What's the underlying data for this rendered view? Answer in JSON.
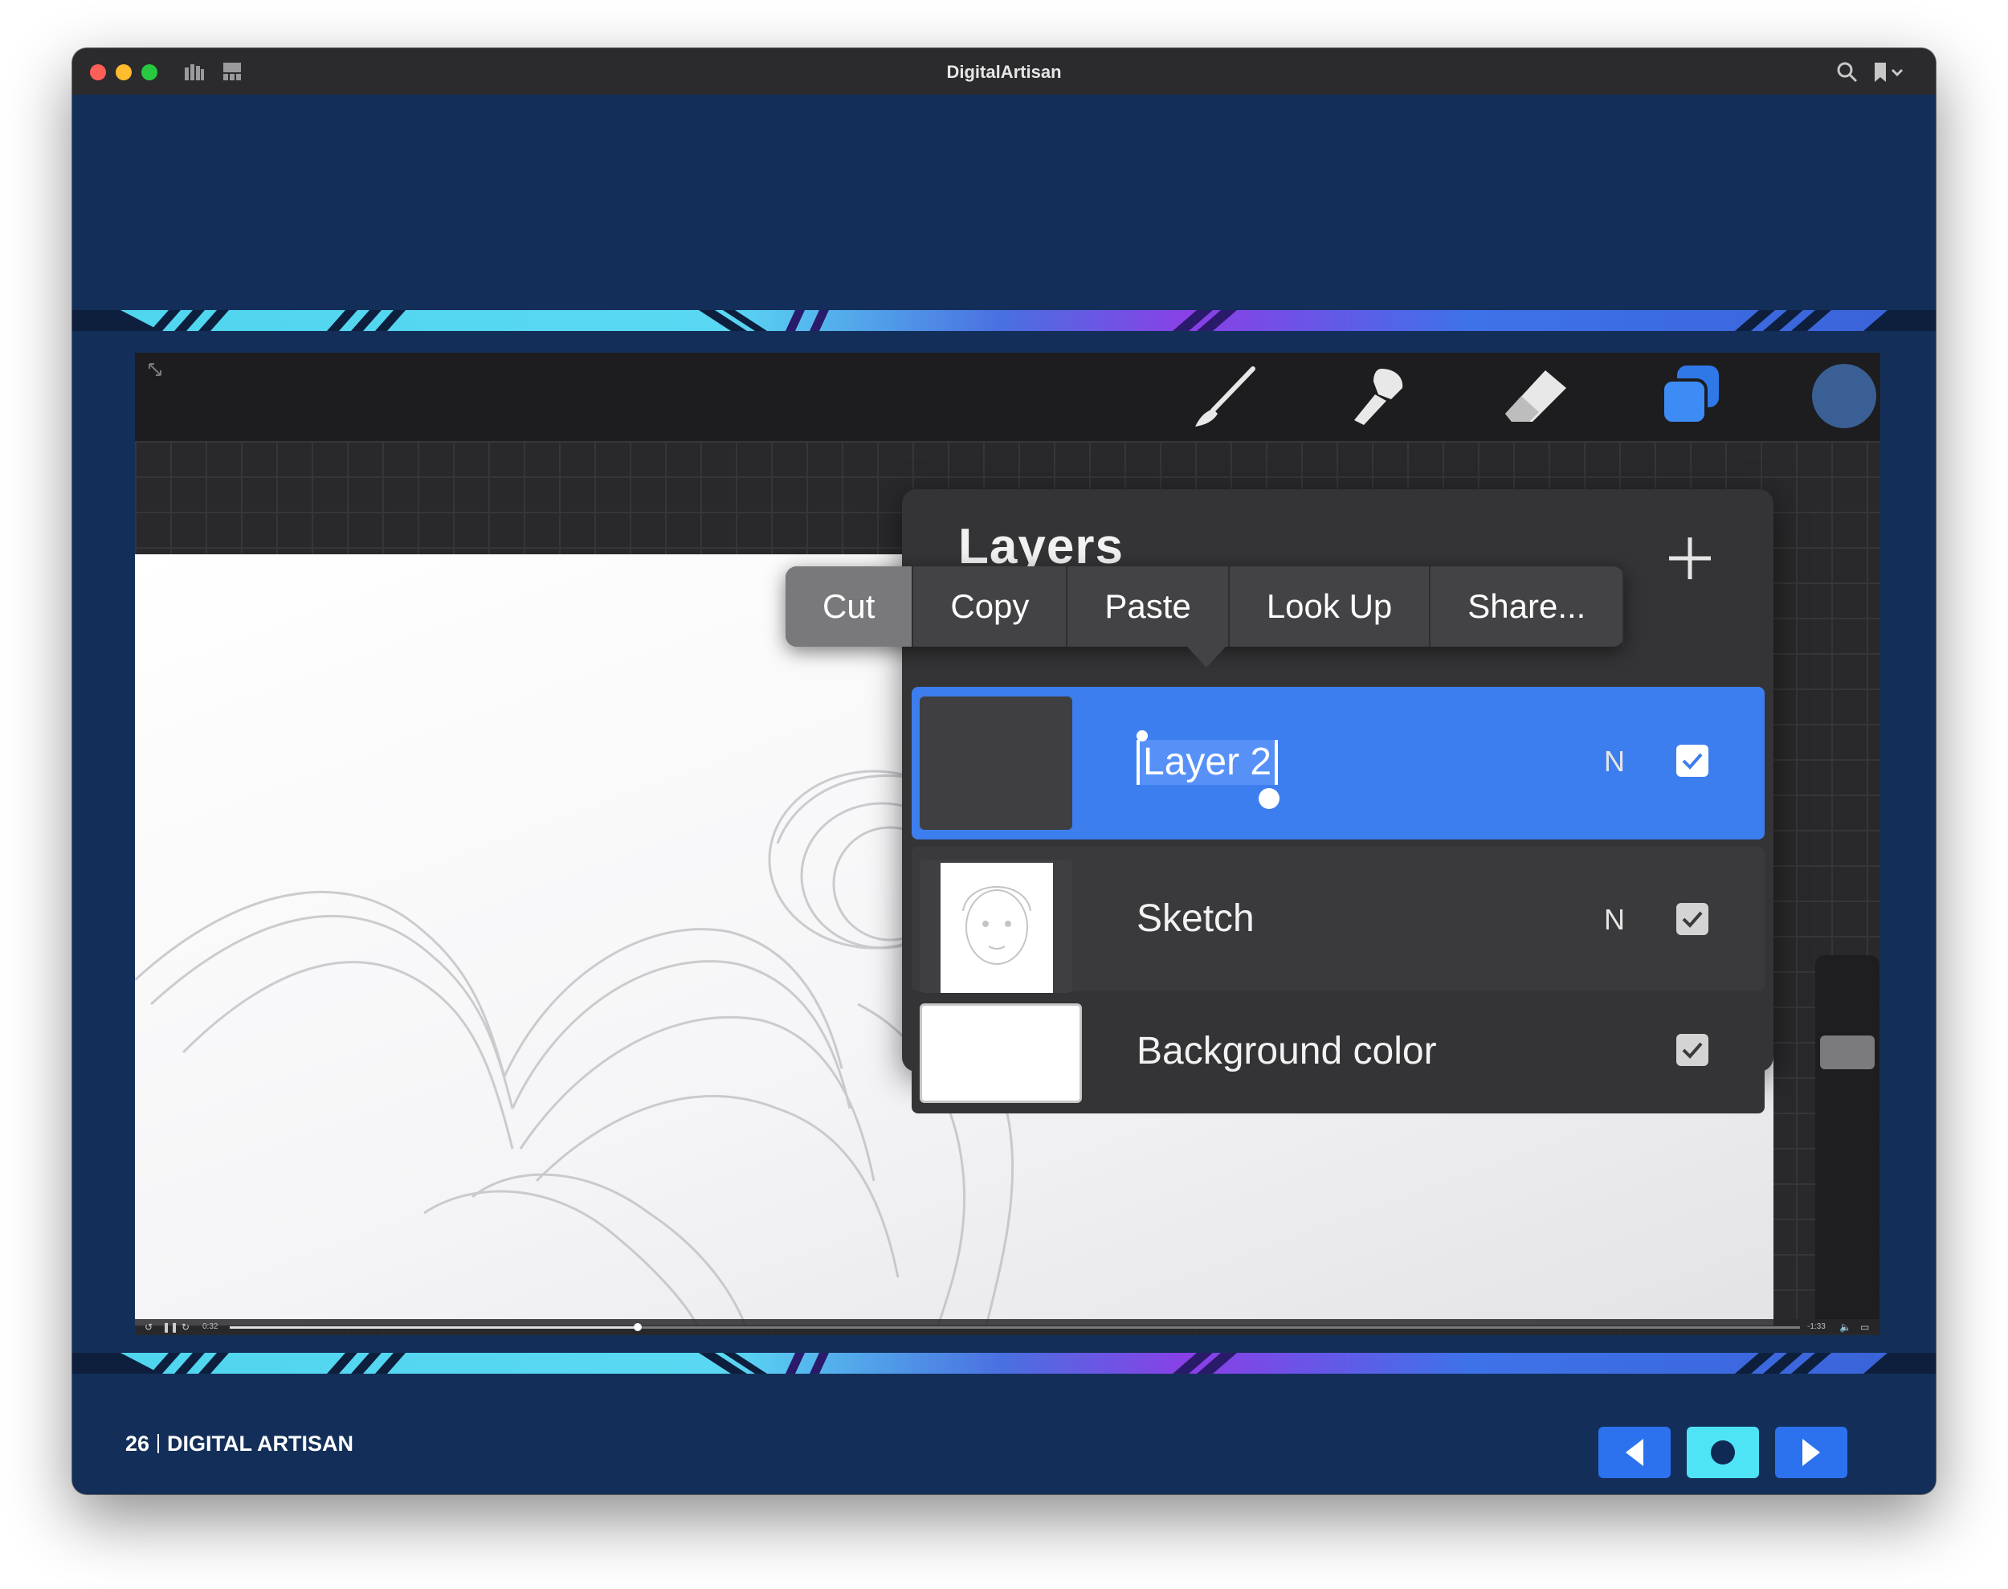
{
  "window": {
    "title": "DigitalArtisan"
  },
  "app_toolbar": {
    "tools": [
      "brush-icon",
      "smudge-icon",
      "eraser-icon",
      "layers-icon",
      "color-swatch"
    ],
    "active_color": "#3a5f95"
  },
  "layers_panel": {
    "title": "Layers",
    "add_label": "+",
    "layers": [
      {
        "name": "Layer 2",
        "blend": "N",
        "visible": true,
        "selected": true
      },
      {
        "name": "Sketch",
        "blend": "N",
        "visible": true,
        "selected": false
      },
      {
        "name": "Background color",
        "blend": "",
        "visible": true,
        "selected": false
      }
    ]
  },
  "context_menu": {
    "items": [
      "Cut",
      "Copy",
      "Paste",
      "Look Up",
      "Share..."
    ]
  },
  "player": {
    "elapsed": "0:32",
    "remaining": "-1:33",
    "progress": 0.26
  },
  "footer": {
    "page_number": "26",
    "publication": "DIGITAL ARTISAN"
  },
  "colors": {
    "page_background": "#132f59",
    "accent_blue": "#3d7eef",
    "nav_cyan": "#4fe3f6"
  }
}
